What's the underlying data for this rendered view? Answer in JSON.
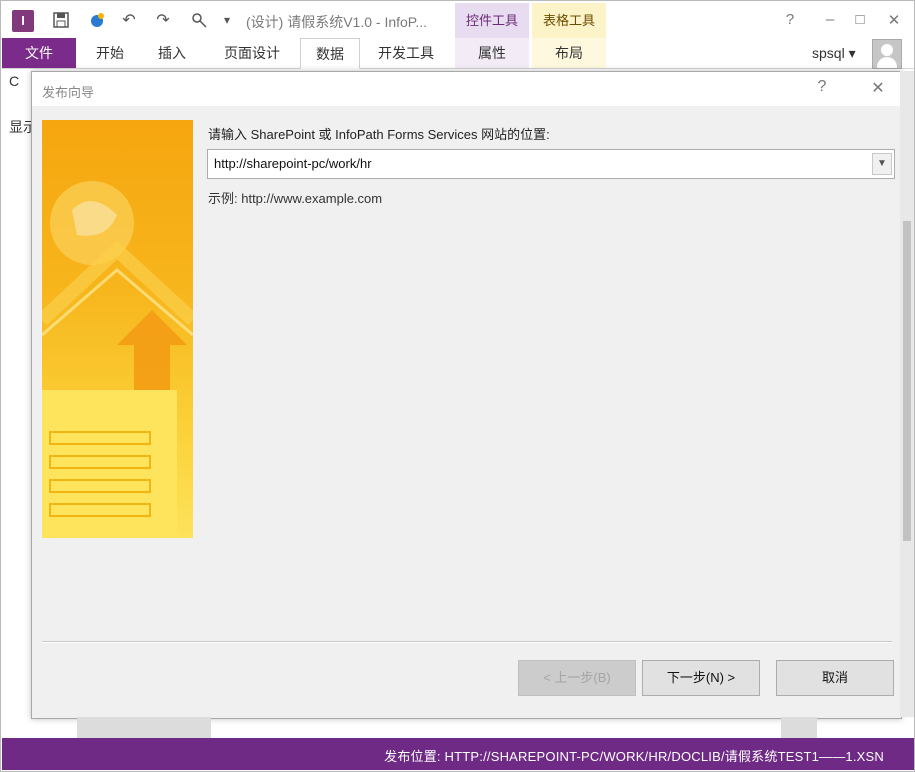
{
  "titlebar": {
    "doc_title": "(设计) 请假系统V1.0 - InfoP...",
    "ctx_control_tools": "控件工具",
    "ctx_table_tools": "表格工具",
    "help": "?",
    "restore": "□",
    "close": "✕",
    "quick_more": "▾"
  },
  "ribbon": {
    "file": "文件",
    "tabs": [
      "开始",
      "插入",
      "页面设计",
      "数据",
      "开发工具",
      "属性",
      "布局"
    ],
    "active_tab": "数据",
    "user": "spsql ▾"
  },
  "background": {
    "stub1": "C",
    "stub2": "显示"
  },
  "dialog": {
    "title": "发布向导",
    "help": "?",
    "close": "✕",
    "prompt": "请输入 SharePoint 或 InfoPath Forms Services 网站的位置:",
    "location_value": "http://sharepoint-pc/work/hr",
    "example": "示例: http://www.example.com",
    "prev_button": "< 上一步(B)",
    "next_button": "下一步(N) >",
    "cancel_button": "取消"
  },
  "statusbar": {
    "text": "发布位置: HTTP://SHAREPOINT-PC/WORK/HR/DOCLIB/请假系统TEST1——1.XSN"
  },
  "colors": {
    "accent": "#7b2c8a",
    "status": "#6e2a85",
    "banner": "#f7b51c"
  }
}
